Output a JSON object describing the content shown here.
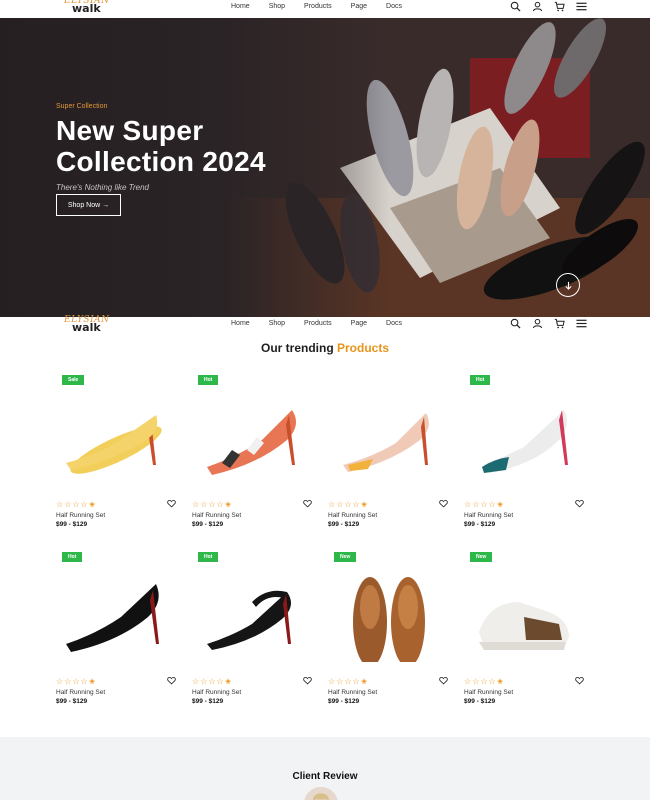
{
  "brand": {
    "logo_top": "ELYSIAN",
    "logo_bottom": "walk"
  },
  "nav": {
    "links": [
      "Home",
      "Shop",
      "Products",
      "Page",
      "Docs"
    ]
  },
  "icons": [
    "search-icon",
    "user-icon",
    "cart-icon",
    "menu-icon"
  ],
  "hero": {
    "kicker": "Super Collection",
    "title_line1": "New Super",
    "title_line2": "Collection 2024",
    "subtitle": "There's Nothing like Trend",
    "button": "Shop Now →"
  },
  "products_section": {
    "title_main": "Our trending ",
    "title_accent": "Products"
  },
  "products": [
    {
      "badge": "Sale",
      "badge_color": "#2fb84a",
      "name": "Half Running Set",
      "price": "$99 - $129",
      "rating": 4.5
    },
    {
      "badge": "Hot",
      "badge_color": "#2fb84a",
      "name": "Half Running Set",
      "price": "$99 - $129",
      "rating": 4.5
    },
    {
      "badge": "",
      "badge_color": "#2fb84a",
      "name": "Half Running Set",
      "price": "$99 - $129",
      "rating": 4.5
    },
    {
      "badge": "Hot",
      "badge_color": "#2fb84a",
      "name": "Half Running Set",
      "price": "$99 - $129",
      "rating": 4.5
    },
    {
      "badge": "Hot",
      "badge_color": "#2fb84a",
      "name": "Half Running Set",
      "price": "$99 - $129",
      "rating": 4.5
    },
    {
      "badge": "Hot",
      "badge_color": "#2fb84a",
      "name": "Half Running Set",
      "price": "$99 - $129",
      "rating": 4.5
    },
    {
      "badge": "New",
      "badge_color": "#2fb84a",
      "name": "Half Running Set",
      "price": "$99 - $129",
      "rating": 4.5
    },
    {
      "badge": "New",
      "badge_color": "#2fb84a",
      "name": "Half Running Set",
      "price": "$99 - $129",
      "rating": 4.5
    }
  ],
  "stars_text": "☆☆☆☆✬",
  "review": {
    "title": "Client Review"
  },
  "colors": {
    "accent": "#e8941a",
    "badge": "#2fb84a",
    "hero_bg": "#2a2224"
  }
}
